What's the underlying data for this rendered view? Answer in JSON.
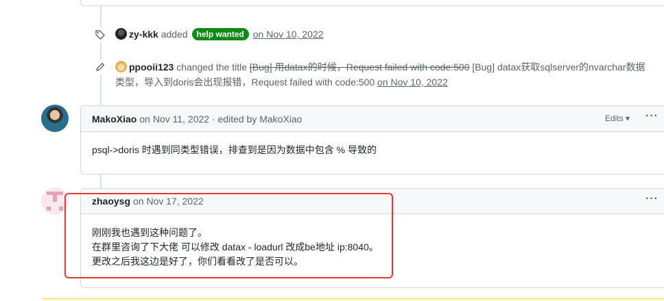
{
  "events": [
    {
      "actor": "zy-kkk",
      "action": "added",
      "label": "help wanted",
      "timestamp": "on Nov 10, 2022"
    },
    {
      "actor": "ppooii123",
      "action": "changed the title",
      "old_title": "[Bug] 用datax的时候，Request failed with code:500",
      "new_title": "[Bug] datax获取sqlserver的nvarchar数据类型，导入到doris会出现报错，Request failed with code:500",
      "timestamp": "on Nov 10, 2022"
    }
  ],
  "comments": [
    {
      "author": "MakoXiao",
      "meta": "on Nov 11, 2022 · edited by MakoXiao",
      "edits_label": "Edits",
      "body": [
        "psql->doris 时遇到同类型错误，排查到是因为数据中包含 % 导致的"
      ]
    },
    {
      "author": "zhaoysg",
      "meta": "on Nov 17, 2022",
      "body": [
        "刚刚我也遇到这种问题了。",
        "在群里咨询了下大佬 可以修改 datax - loadurl 改成be地址 ip:8040。",
        "更改之后我这边是好了，你们看看改了是否可以。"
      ]
    }
  ],
  "colors": {
    "label_bg": "#0e8a16",
    "highlight_border": "#e03a2f"
  },
  "icons": [
    "tag-icon",
    "pencil-icon",
    "kebab-icon",
    "triangle-down-icon"
  ]
}
